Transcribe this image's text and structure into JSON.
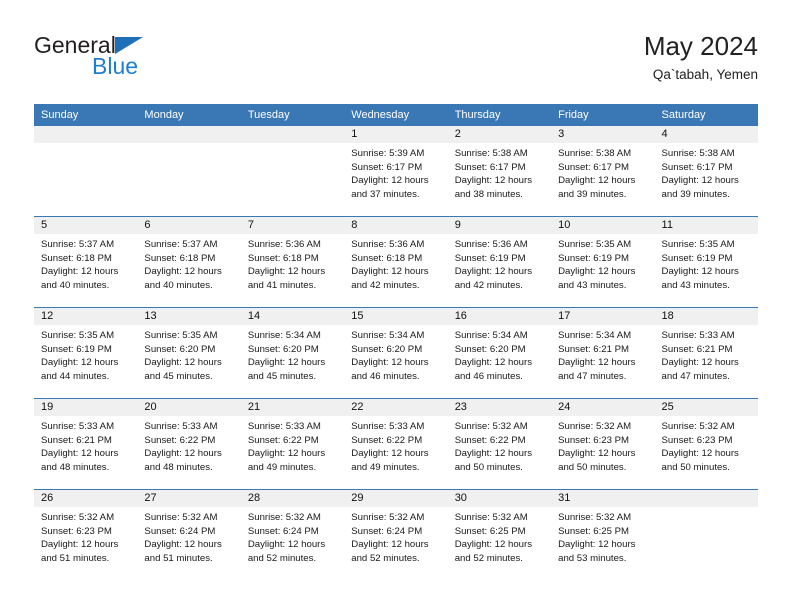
{
  "brand": {
    "name_top": "General",
    "name_bottom": "Blue",
    "triangle_color": "#1e6fb8",
    "blue_text_color": "#1e7fd0"
  },
  "header": {
    "title": "May 2024",
    "subtitle": "Qa`tabah, Yemen",
    "accent_color": "#3a77b5",
    "band_color": "#f0f0f0"
  },
  "weekday_headers": [
    "Sunday",
    "Monday",
    "Tuesday",
    "Wednesday",
    "Thursday",
    "Friday",
    "Saturday"
  ],
  "weeks": [
    [
      {
        "day": "",
        "lines": []
      },
      {
        "day": "",
        "lines": []
      },
      {
        "day": "",
        "lines": []
      },
      {
        "day": "1",
        "lines": [
          "Sunrise: 5:39 AM",
          "Sunset: 6:17 PM",
          "Daylight: 12 hours",
          "and 37 minutes."
        ]
      },
      {
        "day": "2",
        "lines": [
          "Sunrise: 5:38 AM",
          "Sunset: 6:17 PM",
          "Daylight: 12 hours",
          "and 38 minutes."
        ]
      },
      {
        "day": "3",
        "lines": [
          "Sunrise: 5:38 AM",
          "Sunset: 6:17 PM",
          "Daylight: 12 hours",
          "and 39 minutes."
        ]
      },
      {
        "day": "4",
        "lines": [
          "Sunrise: 5:38 AM",
          "Sunset: 6:17 PM",
          "Daylight: 12 hours",
          "and 39 minutes."
        ]
      }
    ],
    [
      {
        "day": "5",
        "lines": [
          "Sunrise: 5:37 AM",
          "Sunset: 6:18 PM",
          "Daylight: 12 hours",
          "and 40 minutes."
        ]
      },
      {
        "day": "6",
        "lines": [
          "Sunrise: 5:37 AM",
          "Sunset: 6:18 PM",
          "Daylight: 12 hours",
          "and 40 minutes."
        ]
      },
      {
        "day": "7",
        "lines": [
          "Sunrise: 5:36 AM",
          "Sunset: 6:18 PM",
          "Daylight: 12 hours",
          "and 41 minutes."
        ]
      },
      {
        "day": "8",
        "lines": [
          "Sunrise: 5:36 AM",
          "Sunset: 6:18 PM",
          "Daylight: 12 hours",
          "and 42 minutes."
        ]
      },
      {
        "day": "9",
        "lines": [
          "Sunrise: 5:36 AM",
          "Sunset: 6:19 PM",
          "Daylight: 12 hours",
          "and 42 minutes."
        ]
      },
      {
        "day": "10",
        "lines": [
          "Sunrise: 5:35 AM",
          "Sunset: 6:19 PM",
          "Daylight: 12 hours",
          "and 43 minutes."
        ]
      },
      {
        "day": "11",
        "lines": [
          "Sunrise: 5:35 AM",
          "Sunset: 6:19 PM",
          "Daylight: 12 hours",
          "and 43 minutes."
        ]
      }
    ],
    [
      {
        "day": "12",
        "lines": [
          "Sunrise: 5:35 AM",
          "Sunset: 6:19 PM",
          "Daylight: 12 hours",
          "and 44 minutes."
        ]
      },
      {
        "day": "13",
        "lines": [
          "Sunrise: 5:35 AM",
          "Sunset: 6:20 PM",
          "Daylight: 12 hours",
          "and 45 minutes."
        ]
      },
      {
        "day": "14",
        "lines": [
          "Sunrise: 5:34 AM",
          "Sunset: 6:20 PM",
          "Daylight: 12 hours",
          "and 45 minutes."
        ]
      },
      {
        "day": "15",
        "lines": [
          "Sunrise: 5:34 AM",
          "Sunset: 6:20 PM",
          "Daylight: 12 hours",
          "and 46 minutes."
        ]
      },
      {
        "day": "16",
        "lines": [
          "Sunrise: 5:34 AM",
          "Sunset: 6:20 PM",
          "Daylight: 12 hours",
          "and 46 minutes."
        ]
      },
      {
        "day": "17",
        "lines": [
          "Sunrise: 5:34 AM",
          "Sunset: 6:21 PM",
          "Daylight: 12 hours",
          "and 47 minutes."
        ]
      },
      {
        "day": "18",
        "lines": [
          "Sunrise: 5:33 AM",
          "Sunset: 6:21 PM",
          "Daylight: 12 hours",
          "and 47 minutes."
        ]
      }
    ],
    [
      {
        "day": "19",
        "lines": [
          "Sunrise: 5:33 AM",
          "Sunset: 6:21 PM",
          "Daylight: 12 hours",
          "and 48 minutes."
        ]
      },
      {
        "day": "20",
        "lines": [
          "Sunrise: 5:33 AM",
          "Sunset: 6:22 PM",
          "Daylight: 12 hours",
          "and 48 minutes."
        ]
      },
      {
        "day": "21",
        "lines": [
          "Sunrise: 5:33 AM",
          "Sunset: 6:22 PM",
          "Daylight: 12 hours",
          "and 49 minutes."
        ]
      },
      {
        "day": "22",
        "lines": [
          "Sunrise: 5:33 AM",
          "Sunset: 6:22 PM",
          "Daylight: 12 hours",
          "and 49 minutes."
        ]
      },
      {
        "day": "23",
        "lines": [
          "Sunrise: 5:32 AM",
          "Sunset: 6:22 PM",
          "Daylight: 12 hours",
          "and 50 minutes."
        ]
      },
      {
        "day": "24",
        "lines": [
          "Sunrise: 5:32 AM",
          "Sunset: 6:23 PM",
          "Daylight: 12 hours",
          "and 50 minutes."
        ]
      },
      {
        "day": "25",
        "lines": [
          "Sunrise: 5:32 AM",
          "Sunset: 6:23 PM",
          "Daylight: 12 hours",
          "and 50 minutes."
        ]
      }
    ],
    [
      {
        "day": "26",
        "lines": [
          "Sunrise: 5:32 AM",
          "Sunset: 6:23 PM",
          "Daylight: 12 hours",
          "and 51 minutes."
        ]
      },
      {
        "day": "27",
        "lines": [
          "Sunrise: 5:32 AM",
          "Sunset: 6:24 PM",
          "Daylight: 12 hours",
          "and 51 minutes."
        ]
      },
      {
        "day": "28",
        "lines": [
          "Sunrise: 5:32 AM",
          "Sunset: 6:24 PM",
          "Daylight: 12 hours",
          "and 52 minutes."
        ]
      },
      {
        "day": "29",
        "lines": [
          "Sunrise: 5:32 AM",
          "Sunset: 6:24 PM",
          "Daylight: 12 hours",
          "and 52 minutes."
        ]
      },
      {
        "day": "30",
        "lines": [
          "Sunrise: 5:32 AM",
          "Sunset: 6:25 PM",
          "Daylight: 12 hours",
          "and 52 minutes."
        ]
      },
      {
        "day": "31",
        "lines": [
          "Sunrise: 5:32 AM",
          "Sunset: 6:25 PM",
          "Daylight: 12 hours",
          "and 53 minutes."
        ]
      },
      {
        "day": "",
        "lines": []
      }
    ]
  ]
}
